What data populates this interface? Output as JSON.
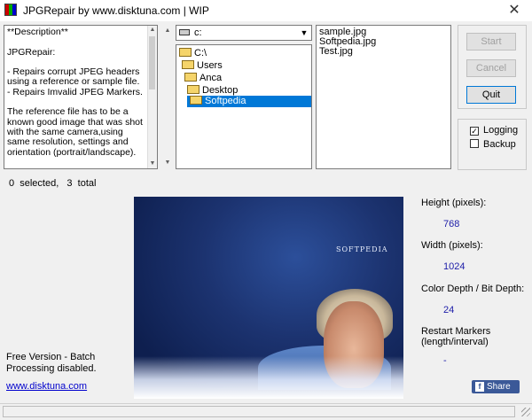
{
  "window": {
    "title": "JPGRepair by www.disktuna.com | WIP",
    "close_glyph": "✕"
  },
  "description": {
    "text": "**Description**\n\nJPGRepair:\n\n- Repairs corrupt JPEG headers using a reference or sample file.\n- Repairs Imvalid JPEG Markers.\n\nThe reference file has to be a known good image that was shot with the same camera,using same resolution, settings and orientation (portrait/landscape)."
  },
  "drive": {
    "value": "c:"
  },
  "folders": [
    {
      "label": "C:\\",
      "selected": false
    },
    {
      "label": "Users",
      "selected": false
    },
    {
      "label": "Anca",
      "selected": false
    },
    {
      "label": "Desktop",
      "selected": false
    },
    {
      "label": "Softpedia",
      "selected": true
    }
  ],
  "files": [
    "sample.jpg",
    "Softpedia.jpg",
    "Test.jpg"
  ],
  "buttons": {
    "start": "Start",
    "cancel": "Cancel",
    "quit": "Quit"
  },
  "options": {
    "logging": {
      "label": "Logging",
      "checked": true
    },
    "backup": {
      "label": "Backup",
      "checked": false
    }
  },
  "status": {
    "selection": "0  selected,   3  total"
  },
  "preview": {
    "logo_text": "SOFTPEDIA"
  },
  "image_info": {
    "height_label": "Height (pixels):",
    "height_value": "768",
    "width_label": "Width (pixels):",
    "width_value": "1024",
    "depth_label": "Color Depth / Bit Depth:",
    "depth_value": "24",
    "restart_label_1": "Restart Markers",
    "restart_label_2": "(length/interval)",
    "restart_value": "-"
  },
  "footer": {
    "free_note": "Free Version - Batch Processing disabled.",
    "link": "www.disktuna.com",
    "share": "Share",
    "share_icon": "f"
  },
  "icons": {
    "drive_arrow": "▼",
    "scroll_up": "▲",
    "scroll_down": "▼",
    "check_mark": "✓"
  }
}
